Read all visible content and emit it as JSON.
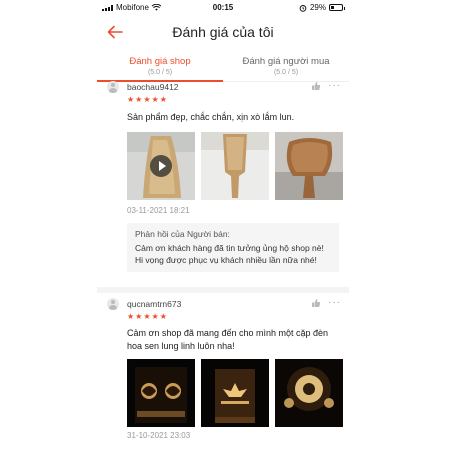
{
  "status_bar": {
    "carrier": "Mobifone",
    "time": "00:15",
    "battery": "29%"
  },
  "header": {
    "title": "Đánh giá của tôi"
  },
  "tabs": [
    {
      "label": "Đánh giá shop",
      "sub": "(5.0 / 5)",
      "active": true
    },
    {
      "label": "Đánh giá người mua",
      "sub": "(5.0 / 5)",
      "active": false
    }
  ],
  "reviews": [
    {
      "username": "baochau9412",
      "stars": "★★★★★",
      "text": "Sản phẩm đẹp, chắc chắn, xịn xò lắm lun.",
      "date": "03-11-2021 18:21",
      "reply_title": "Phản hồi của Người bán:",
      "reply_text": "Cảm ơn khách hàng đã tin tưởng ủng hộ shop nè! Hi vọng được phục vụ khách nhiều lần nữa nhé!"
    },
    {
      "username": "qucnamtrn673",
      "stars": "★★★★★",
      "text": "Cảm ơn shop đã mang đến cho mình một cặp đèn hoa sen lung linh luôn nha!",
      "date": "31-10-2021 23:03"
    }
  ],
  "colors": {
    "accent": "#ee4d2d"
  },
  "icons": {
    "back": "arrow-left-icon",
    "like": "thumbs-up-icon",
    "more": "more-dots-icon",
    "play": "play-icon"
  }
}
